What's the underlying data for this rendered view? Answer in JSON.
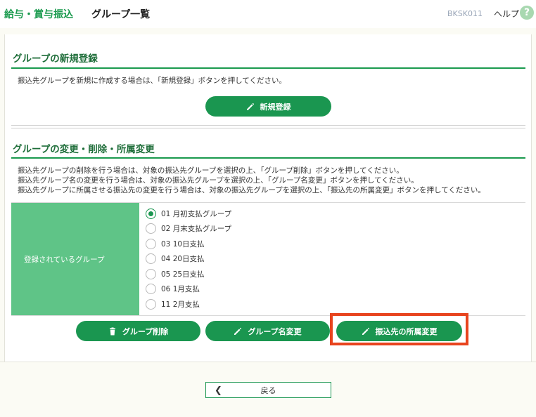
{
  "header": {
    "brand": "給与・賞与振込",
    "title": "グループ一覧",
    "screen_id": "BKSK011",
    "help_label": "ヘルプ",
    "help_icon": "help-circle-icon"
  },
  "new_registration": {
    "title": "グループの新規登録",
    "description": "振込先グループを新規に作成する場合は、「新規登録」ボタンを押してください。",
    "button_label": "新規登録"
  },
  "modify": {
    "title": "グループの変更・削除・所属変更",
    "descriptions": [
      "振込先グループの削除を行う場合は、対象の振込先グループを選択の上、「グループ削除」ボタンを押してください。",
      "振込先グループ名の変更を行う場合は、対象の振込先グループを選択の上、「グループ名変更」ボタンを押してください。",
      "振込先グループに所属させる振込先の変更を行う場合は、対象の振込先グループを選択の上、「振込先の所属変更」ボタンを押してください。"
    ],
    "table_header": "登録されているグループ",
    "groups": [
      {
        "label": "01 月初支払グループ",
        "selected": true
      },
      {
        "label": "02 月末支払グループ",
        "selected": false
      },
      {
        "label": "03 10日支払",
        "selected": false
      },
      {
        "label": "04 20日支払",
        "selected": false
      },
      {
        "label": "05 25日支払",
        "selected": false
      },
      {
        "label": "06 1月支払",
        "selected": false
      },
      {
        "label": "11 2月支払",
        "selected": false
      }
    ],
    "buttons": {
      "delete_label": "グループ削除",
      "rename_label": "グループ名変更",
      "reassign_label": "振込先の所属変更"
    }
  },
  "footer": {
    "back_label": "戻る"
  },
  "colors": {
    "accent": "#1a9650",
    "table_header_bg": "#5fc487",
    "highlight": "#e8441e"
  }
}
